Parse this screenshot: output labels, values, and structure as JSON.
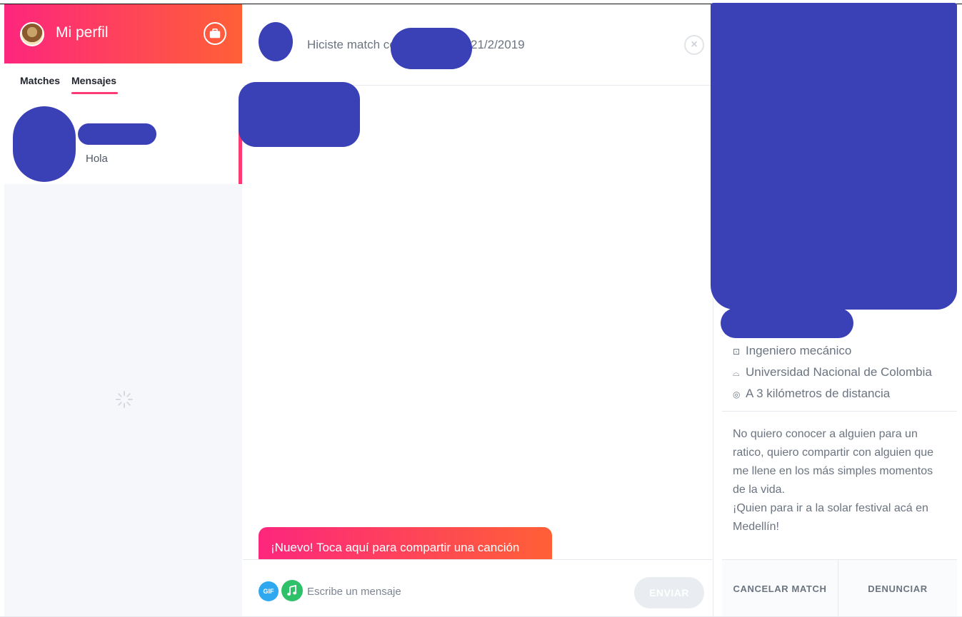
{
  "sidebar": {
    "profile_title": "Mi perfil",
    "tabs": [
      {
        "label": "Matches"
      },
      {
        "label": "Mensajes"
      }
    ],
    "conversations": [
      {
        "preview": "Hola"
      }
    ]
  },
  "chat": {
    "match_text": "Hiciste match co",
    "match_date": "21/2/2019",
    "tooltip": "¡Nuevo! Toca aquí para compartir una canción",
    "gif_label": "GIF",
    "input_placeholder": "Escribe un mensaje",
    "send_label": "ENVIAR"
  },
  "profile": {
    "job": "Ingeniero mecánico",
    "school": "Universidad Nacional de Colombia",
    "distance": "A 3 kilómetros de distancia",
    "bio": "No quiero conocer a alguien para un ratico, quiero compartir con alguien que me llene en los más simples momentos de la vida.\n¡Quien para ir a la solar festival acá en Medellín!",
    "unmatch_label": "CANCELAR MATCH",
    "report_label": "DENUNCIAR"
  },
  "colors": {
    "gradient_start": "#fd267d",
    "gradient_end": "#ff6036",
    "redaction": "#3a40b5",
    "gif": "#2fa8f0",
    "music": "#2fc16a"
  },
  "icons": {
    "job": "briefcase-icon",
    "school": "graduation-cap-icon",
    "distance": "location-pin-icon"
  }
}
